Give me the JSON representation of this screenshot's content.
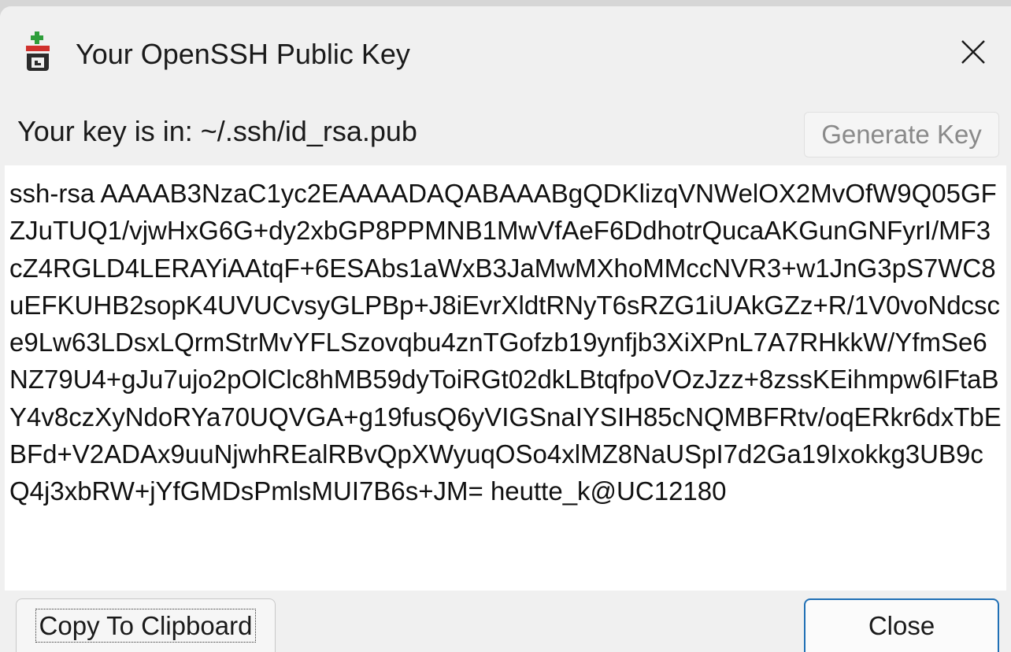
{
  "window": {
    "title": "Your OpenSSH Public Key",
    "icon": "git-gui-icon",
    "close_icon": "close-icon"
  },
  "key_location": {
    "label": "Your key is in: ~/.ssh/id_rsa.pub"
  },
  "buttons": {
    "generate_label": "Generate Key",
    "generate_enabled": false,
    "copy_label": "Copy To Clipboard",
    "close_label": "Close"
  },
  "public_key": {
    "text": "ssh-rsa AAAAB3NzaC1yc2EAAAADAQABAAABgQDKlizqVNWelOX2MvOfW9Q05GFZJuTUQ1/vjwHxG6G+dy2xbGP8PPMNB1MwVfAeF6DdhotrQucaAKGunGNFyrI/MF3cZ4RGLD4LERAYiAAtqF+6ESAbs1aWxB3JaMwMXhoMMccNVR3+w1JnG3pS7WC8uEFKUHB2sopK4UVUCvsyGLPBp+J8iEvrXldtRNyT6sRZG1iUAkGZz+R/1V0voNdcsce9Lw63LDsxLQrmStrMvYFLSzovqbu4znTGofzb19ynfjb3XiXPnL7A7RHkkW/YfmSe6NZ79U4+gJu7ujo2pOlClc8hMB59dyToiRGt02dkLBtqfpoVOzJzz+8zssKEihmpw6IFtaBY4v8czXyNdoRYa70UQVGA+g19fusQ6yVIGSnaIYSIH85cNQMBFRtv/oqERkr6dxTbEBFd+V2ADAx9uuNjwhREalRBvQpXWyuqOSo4xlMZ8NaUSpI7d2Ga19Ixokkg3UB9cQ4j3xbRW+jYfGMDsPmlsMUI7B6s+JM= heutte_k@UC12180"
  },
  "colors": {
    "window_bg": "#f0f0f0",
    "text_area_bg": "#ffffff",
    "disabled_text": "#8a8a8a",
    "default_button_border": "#1f6fb5"
  }
}
